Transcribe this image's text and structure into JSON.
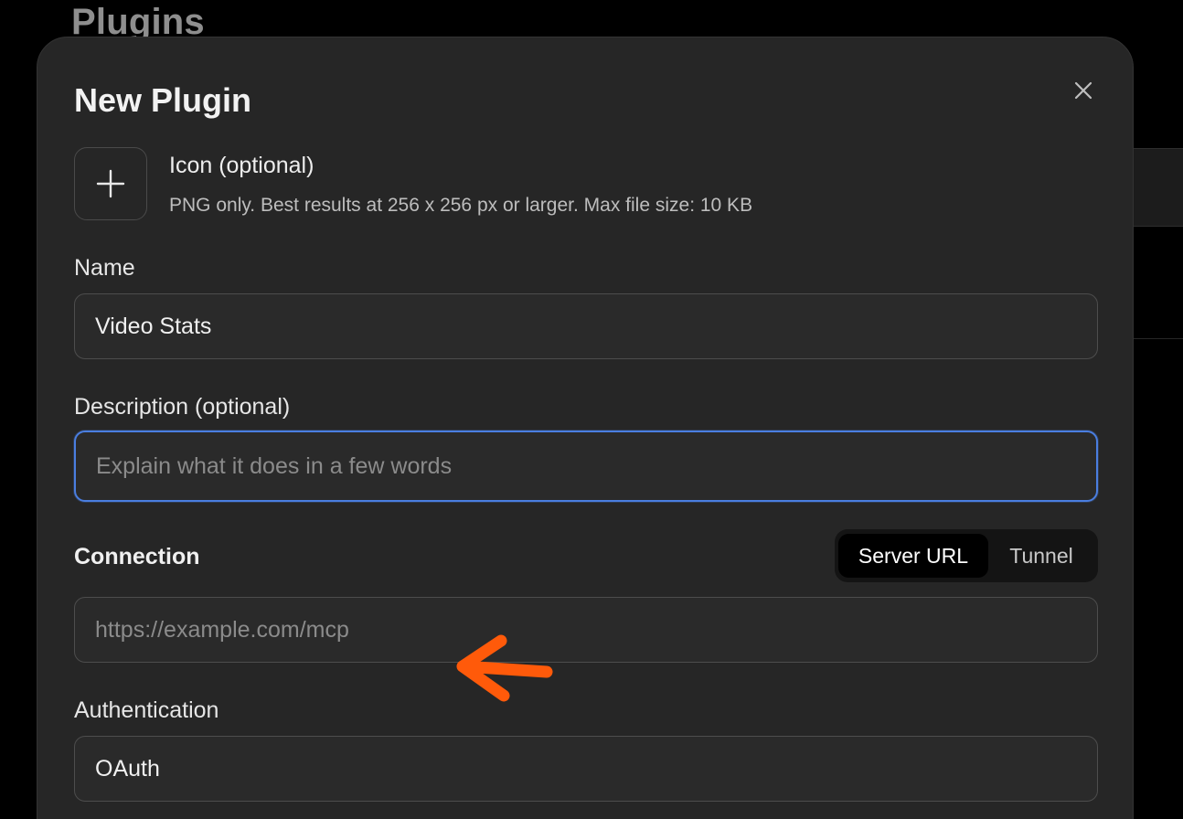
{
  "background": {
    "page_title": "Plugins"
  },
  "modal": {
    "title": "New Plugin",
    "close_icon": "close-icon",
    "icon_upload": {
      "button_icon": "plus-icon",
      "title": "Icon (optional)",
      "help": "PNG only. Best results at 256 x 256 px or larger. Max file size: 10 KB"
    },
    "name": {
      "label": "Name",
      "value": "Video Stats"
    },
    "description": {
      "label": "Description (optional)",
      "placeholder": "Explain what it does in a few words",
      "value": ""
    },
    "connection": {
      "label": "Connection",
      "options": [
        "Server URL",
        "Tunnel"
      ],
      "selected": "Server URL",
      "placeholder": "https://example.com/mcp",
      "annotation_icon": "arrow-left-icon",
      "annotation_color": "#ff5a0a"
    },
    "authentication": {
      "label": "Authentication",
      "value": "OAuth"
    }
  },
  "colors": {
    "focus_ring": "#4a7ee0",
    "modal_bg": "#262626"
  }
}
